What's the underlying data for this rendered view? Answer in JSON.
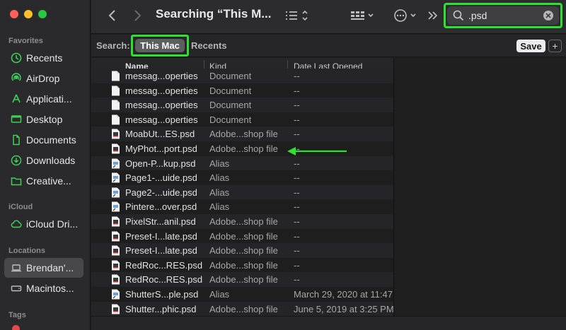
{
  "sidebar": {
    "sections": {
      "favorites": "Favorites",
      "icloud": "iCloud",
      "locations": "Locations",
      "tags": "Tags"
    },
    "favorites": [
      {
        "label": "Recents",
        "icon": "clock-icon"
      },
      {
        "label": "AirDrop",
        "icon": "airdrop-icon"
      },
      {
        "label": "Applicati...",
        "icon": "applications-icon"
      },
      {
        "label": "Desktop",
        "icon": "desktop-icon"
      },
      {
        "label": "Documents",
        "icon": "document-icon"
      },
      {
        "label": "Downloads",
        "icon": "download-icon"
      },
      {
        "label": "Creative...",
        "icon": "folder-icon"
      }
    ],
    "icloud": [
      {
        "label": "iCloud Dri...",
        "icon": "cloud-icon"
      }
    ],
    "locations": [
      {
        "label": "Brendan'...",
        "icon": "laptop-icon",
        "selected": true
      },
      {
        "label": "Macintos...",
        "icon": "disk-icon"
      }
    ]
  },
  "toolbar": {
    "title": "Searching “This M...",
    "search": {
      "value": ".psd"
    }
  },
  "scope": {
    "label": "Search:",
    "this_mac": "This Mac",
    "recents": "Recents",
    "save": "Save",
    "add": "+"
  },
  "columns": {
    "name": "Name",
    "kind": "Kind",
    "date": "Date Last Opened"
  },
  "files": [
    {
      "name": "messag...operties",
      "kind": "Document",
      "date": "--",
      "icon": "document-icon"
    },
    {
      "name": "messag...operties",
      "kind": "Document",
      "date": "--",
      "icon": "document-icon"
    },
    {
      "name": "messag...operties",
      "kind": "Document",
      "date": "--",
      "icon": "document-icon"
    },
    {
      "name": "messag...operties",
      "kind": "Document",
      "date": "--",
      "icon": "document-icon"
    },
    {
      "name": "MoabUt...ES.psd",
      "kind": "Adobe...shop file",
      "date": "--",
      "icon": "psd-icon"
    },
    {
      "name": "MyPhot...port.psd",
      "kind": "Adobe...shop file",
      "date": "--",
      "icon": "psd-icon"
    },
    {
      "name": "Open-P...kup.psd",
      "kind": "Alias",
      "date": "--",
      "icon": "alias-icon"
    },
    {
      "name": "Page1-...uide.psd",
      "kind": "Alias",
      "date": "--",
      "icon": "alias-icon"
    },
    {
      "name": "Page2-...uide.psd",
      "kind": "Alias",
      "date": "--",
      "icon": "alias-icon"
    },
    {
      "name": "Pintere...over.psd",
      "kind": "Alias",
      "date": "--",
      "icon": "alias-icon"
    },
    {
      "name": "PixelStr...anil.psd",
      "kind": "Adobe...shop file",
      "date": "--",
      "icon": "psd-icon"
    },
    {
      "name": "Preset-I...late.psd",
      "kind": "Adobe...shop file",
      "date": "--",
      "icon": "psd-icon"
    },
    {
      "name": "Preset-I...late.psd",
      "kind": "Adobe...shop file",
      "date": "--",
      "icon": "psd-icon"
    },
    {
      "name": "RedRoc...RES.psd",
      "kind": "Adobe...shop file",
      "date": "--",
      "icon": "psd-icon"
    },
    {
      "name": "RedRoc...RES.psd",
      "kind": "Adobe...shop file",
      "date": "--",
      "icon": "psd-icon"
    },
    {
      "name": "ShutterS...ple.psd",
      "kind": "Alias",
      "date": "March 29, 2020 at 11:47",
      "icon": "alias-icon"
    },
    {
      "name": "Shutter...phic.psd",
      "kind": "Adobe...shop file",
      "date": "June 5, 2019 at 3:25 PM",
      "icon": "psd-icon"
    }
  ],
  "colors": {
    "highlight": "#2ee032",
    "sidebar_icon": "#3fd05a"
  }
}
